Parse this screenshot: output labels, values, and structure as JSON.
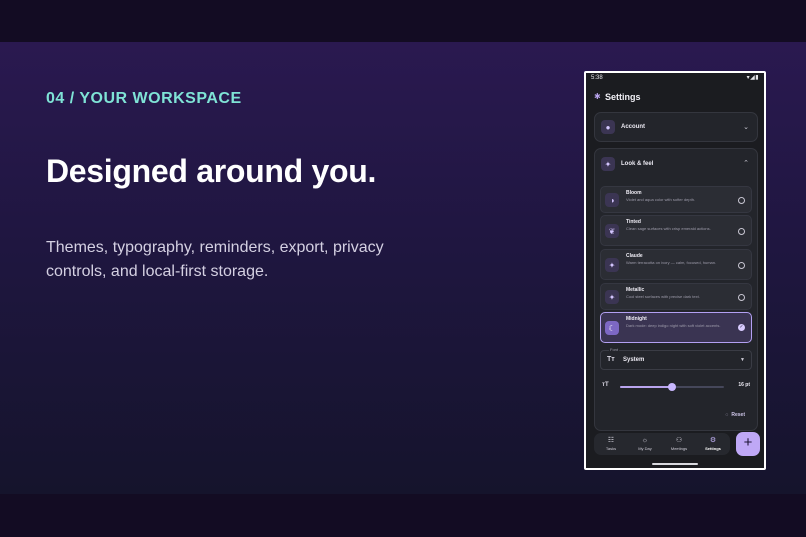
{
  "slide": {
    "eyebrow": "04  /  YOUR WORKSPACE",
    "headline": "Designed around you.",
    "body": "Themes, typography, reminders, export, privacy controls, and local-first storage."
  },
  "phone": {
    "status": {
      "time": "5:38",
      "icons": "▾◢▮"
    },
    "app_title": "Settings",
    "account": {
      "label": "Account"
    },
    "look_and_feel": {
      "label": "Look & feel",
      "themes": [
        {
          "name": "Bloom",
          "desc": "Violet and aqua color with softer depth.",
          "icon": "half-circle-icon",
          "selected": false
        },
        {
          "name": "Tinted",
          "desc": "Clean sage surfaces with crisp emerald actions.",
          "icon": "leaf-icon",
          "selected": false
        },
        {
          "name": "Claude",
          "desc": "Warm terracotta on ivory — calm, focused, human.",
          "icon": "sparkle-icon",
          "selected": false
        },
        {
          "name": "Metallic",
          "desc": "Cool steel surfaces with precise dark text.",
          "icon": "sparkle-icon",
          "selected": false
        },
        {
          "name": "Midnight",
          "desc": "Dark mode: deep indigo night with soft violet accents.",
          "icon": "moon-icon",
          "selected": true
        }
      ],
      "font": {
        "legend": "Font",
        "value": "System"
      },
      "text_size": {
        "value": 0.5,
        "label": "16 pt"
      },
      "reset_label": "Reset"
    },
    "nav": [
      {
        "label": "Tasks",
        "icon": "tasks-icon",
        "active": false
      },
      {
        "label": "My Day",
        "icon": "sun-icon",
        "active": false
      },
      {
        "label": "Meetings",
        "icon": "people-icon",
        "active": false
      },
      {
        "label": "Settings",
        "icon": "gear-icon",
        "active": true
      }
    ],
    "fab_label": "+"
  },
  "colors": {
    "accent": "#b9a4ee",
    "eyebrow": "#7fe3d6",
    "background": "#130c23",
    "screen": "#1b1c20"
  }
}
